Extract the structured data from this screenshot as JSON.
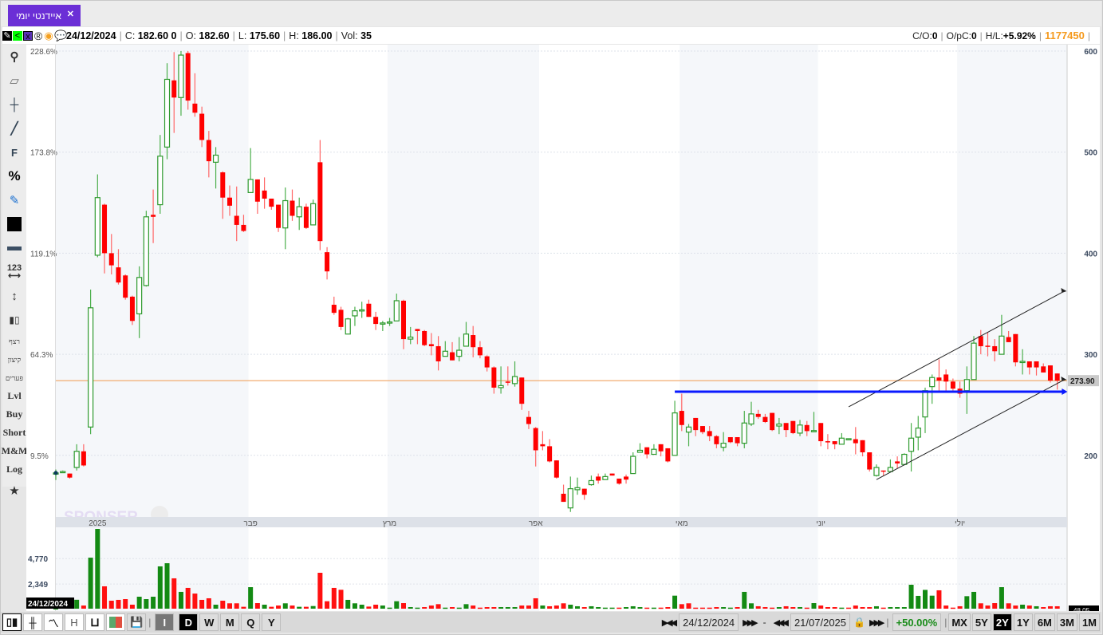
{
  "tab": {
    "title": "איידנטי יומי",
    "close_icon": "close-icon"
  },
  "info": {
    "date": "24/12/2024",
    "c_label": "C:",
    "c_value": "182.60 0",
    "o_label": "O:",
    "o_value": "182.60",
    "l_label": "L:",
    "l_value": "175.60",
    "h_label": "H:",
    "h_value": "186.00",
    "vol_label": "Vol:",
    "vol_value": "35",
    "co_label": "C/O:",
    "co_value": "0",
    "opc_label": "O/pC:",
    "opc_value": "0",
    "hl_label": "H/L:",
    "hl_value": "+5.92%",
    "code": "1177450",
    "icons": [
      "pencil-icon",
      "share-icon",
      "excel-icon",
      "registered-icon",
      "target-icon",
      "comment-icon"
    ]
  },
  "left_toolbar": {
    "icons": [
      "search-icon",
      "eraser-icon",
      "crosshair-icon",
      "line-tool-icon",
      "fibonacci-icon",
      "percent-icon",
      "edit-icon",
      "color-swatch-icon",
      "line-width-icon",
      "measure-icon",
      "vertical-arrow-icon",
      "candles-icon"
    ],
    "f_label": "F",
    "percent_label": "%",
    "measure_label": "123",
    "texts": [
      "רצף",
      "קיצון",
      "פערים",
      "Lvl",
      "Buy",
      "Short",
      "M&M",
      "Log"
    ],
    "star_icon": "star-icon"
  },
  "watermark": "SPONSER",
  "chart_data": {
    "type": "candlestick",
    "price_axis": {
      "ticks": [
        200,
        300,
        400,
        500,
        600
      ],
      "range": [
        130,
        600
      ]
    },
    "percent_axis": [
      "228.6%",
      "173.8%",
      "119.1%",
      "64.3%",
      "9.5%"
    ],
    "percent_axis_prices": [
      600,
      500,
      400,
      300,
      200
    ],
    "month_labels": [
      {
        "label": "2025",
        "index": 6
      },
      {
        "label": "פבר",
        "index": 28
      },
      {
        "label": "מרץ",
        "index": 48
      },
      {
        "label": "אפר",
        "index": 69
      },
      {
        "label": "מאי",
        "index": 90
      },
      {
        "label": "יוני",
        "index": 110
      },
      {
        "label": "יולי",
        "index": 130
      }
    ],
    "last_price": "273.90",
    "last_price_value": 273.9,
    "colors": {
      "up": "#2e9a2e",
      "down": "#ff0000",
      "last_line": "#f0a460",
      "support": "#0a1aff",
      "channel": "#222222"
    },
    "support_line": {
      "price": 263,
      "from_index": 89,
      "to_index": 145
    },
    "channel": [
      {
        "from": [
          114,
          248
        ],
        "to": [
          145,
          362.4
        ]
      },
      {
        "from": [
          118,
          176
        ],
        "to": [
          145,
          274.8
        ]
      }
    ],
    "candles_ohlc": [
      [
        182.6,
        186,
        175.6,
        182.6
      ],
      [
        183,
        185,
        183,
        184
      ],
      [
        182,
        182,
        177,
        178
      ],
      [
        188,
        211,
        185,
        204
      ],
      [
        204,
        211,
        189,
        190
      ],
      [
        228,
        364,
        221,
        346
      ],
      [
        398,
        478,
        396,
        455
      ],
      [
        448,
        449,
        380,
        400
      ],
      [
        400,
        419,
        379,
        388
      ],
      [
        386,
        404,
        369,
        371
      ],
      [
        378,
        379,
        354,
        356
      ],
      [
        357,
        358,
        329,
        333
      ],
      [
        340,
        387,
        316,
        376
      ],
      [
        368,
        442,
        367,
        436
      ],
      [
        438,
        463,
        410,
        436
      ],
      [
        448,
        517,
        439,
        496
      ],
      [
        505,
        588,
        493,
        572
      ],
      [
        571,
        599,
        519,
        554
      ],
      [
        554,
        600,
        536,
        596
      ],
      [
        598,
        600,
        542,
        551
      ],
      [
        548,
        578,
        535,
        539
      ],
      [
        538,
        545,
        505,
        512
      ],
      [
        512,
        521,
        475,
        491
      ],
      [
        490,
        505,
        464,
        497
      ],
      [
        480,
        481,
        434,
        455
      ],
      [
        455,
        467,
        437,
        447
      ],
      [
        437,
        466,
        412,
        428
      ],
      [
        428,
        438,
        421,
        422
      ],
      [
        460,
        504,
        460,
        473
      ],
      [
        473,
        473,
        439,
        451
      ],
      [
        462,
        475,
        444,
        454
      ],
      [
        454,
        454,
        443,
        446
      ],
      [
        448,
        448,
        421,
        425
      ],
      [
        425,
        465,
        404,
        452
      ],
      [
        452,
        463,
        432,
        437
      ],
      [
        436,
        455,
        423,
        446
      ],
      [
        446,
        449,
        424,
        425
      ],
      [
        428,
        453,
        428,
        449
      ],
      [
        490,
        512,
        403,
        412
      ],
      [
        401,
        406,
        374,
        382
      ],
      [
        349,
        357,
        339,
        341
      ],
      [
        344,
        347,
        324,
        327
      ],
      [
        320,
        336,
        320,
        335
      ],
      [
        338,
        347,
        328,
        343
      ],
      [
        343,
        352,
        336,
        344
      ],
      [
        350,
        354,
        337,
        337
      ],
      [
        337,
        342,
        324,
        330
      ],
      [
        330,
        333,
        323,
        331
      ],
      [
        331,
        336,
        328,
        332
      ],
      [
        333,
        360,
        333,
        353
      ],
      [
        353,
        354,
        305,
        315
      ],
      [
        315,
        327,
        310,
        317
      ],
      [
        325,
        325,
        310,
        323
      ],
      [
        323,
        324,
        308,
        309
      ],
      [
        310,
        321,
        299,
        308
      ],
      [
        308,
        318,
        284,
        293
      ],
      [
        298,
        313,
        298,
        303
      ],
      [
        302,
        312,
        294,
        294
      ],
      [
        298,
        317,
        293,
        304
      ],
      [
        308,
        332,
        308,
        320
      ],
      [
        319,
        328,
        297,
        307
      ],
      [
        307,
        313,
        296,
        299
      ],
      [
        298,
        299,
        283,
        287
      ],
      [
        287,
        288,
        261,
        267
      ],
      [
        267,
        288,
        261,
        269
      ],
      [
        273,
        288,
        269,
        272
      ],
      [
        271,
        293,
        268,
        278
      ],
      [
        277,
        277,
        245,
        251
      ],
      [
        238,
        244,
        226,
        231
      ],
      [
        227,
        228,
        189,
        205
      ],
      [
        211,
        224,
        205,
        209
      ],
      [
        209,
        216,
        193,
        194
      ],
      [
        195,
        195,
        177,
        178
      ],
      [
        162,
        171,
        154,
        154
      ],
      [
        148,
        179,
        144,
        167
      ],
      [
        166,
        178,
        161,
        168
      ],
      [
        167,
        167,
        156,
        161
      ],
      [
        171,
        180,
        170,
        175
      ],
      [
        179,
        182,
        172,
        175
      ],
      [
        176,
        182,
        176,
        179
      ],
      [
        182,
        182,
        180,
        180
      ],
      [
        177,
        177,
        171,
        172
      ],
      [
        179,
        181,
        172,
        176
      ],
      [
        182,
        203,
        182,
        199
      ],
      [
        203,
        212,
        203,
        205
      ],
      [
        208,
        208,
        197,
        201
      ],
      [
        201,
        211,
        201,
        206
      ],
      [
        211,
        211,
        199,
        204
      ],
      [
        207,
        207,
        193,
        194
      ],
      [
        200,
        254,
        200,
        242
      ],
      [
        244,
        261,
        224,
        230
      ],
      [
        223,
        231,
        209,
        228
      ],
      [
        237,
        237,
        219,
        225
      ],
      [
        229,
        229,
        221,
        223
      ],
      [
        224,
        229,
        214,
        219
      ],
      [
        219,
        220,
        207,
        211
      ],
      [
        208,
        223,
        204,
        212
      ],
      [
        218,
        218,
        212,
        213
      ],
      [
        218,
        218,
        209,
        212
      ],
      [
        212,
        244,
        207,
        232
      ],
      [
        231,
        253,
        229,
        241
      ],
      [
        241,
        245,
        236,
        238
      ],
      [
        238,
        241,
        232,
        233
      ],
      [
        242,
        242,
        224,
        225
      ],
      [
        229,
        237,
        221,
        231
      ],
      [
        232,
        232,
        218,
        225
      ],
      [
        234,
        234,
        221,
        222
      ],
      [
        222,
        235,
        219,
        230
      ],
      [
        230,
        234,
        219,
        224
      ],
      [
        224,
        243,
        223,
        224.5
      ],
      [
        232,
        232,
        209,
        214
      ],
      [
        214,
        221,
        206,
        213
      ],
      [
        214,
        214,
        206,
        211
      ],
      [
        211,
        222,
        211,
        217
      ],
      [
        216,
        216.5,
        215.5,
        216.5
      ],
      [
        216,
        228,
        201,
        212
      ],
      [
        215,
        215,
        199,
        203
      ],
      [
        203,
        203,
        184,
        186
      ],
      [
        180,
        191,
        179,
        188
      ],
      [
        185,
        185,
        180,
        184
      ],
      [
        184,
        196,
        183,
        188
      ],
      [
        194,
        199,
        187,
        192
      ],
      [
        191,
        202,
        190,
        201
      ],
      [
        204,
        232,
        184,
        217
      ],
      [
        218,
        239,
        205,
        227
      ],
      [
        238,
        267,
        222,
        264
      ],
      [
        268,
        280,
        251,
        277
      ],
      [
        277,
        295,
        264,
        274
      ],
      [
        280,
        285,
        264,
        273
      ],
      [
        273,
        276,
        264,
        266
      ],
      [
        266,
        273,
        257,
        261
      ],
      [
        264,
        288,
        241,
        275
      ],
      [
        275,
        318,
        275,
        311
      ],
      [
        318,
        324,
        300,
        308
      ],
      [
        308.5,
        322,
        298,
        308
      ],
      [
        308,
        315,
        293,
        303
      ],
      [
        300,
        339,
        300,
        318
      ],
      [
        317,
        323,
        312,
        312
      ],
      [
        320,
        320,
        288,
        292
      ],
      [
        292.7,
        305,
        280,
        293
      ],
      [
        293,
        293,
        280,
        287
      ],
      [
        293,
        293,
        279,
        287
      ],
      [
        288,
        291,
        282,
        282
      ],
      [
        289,
        289,
        272,
        274
      ],
      [
        281,
        281,
        265,
        273.9
      ]
    ],
    "volume_axis": {
      "ticks": [
        "4,770",
        "2,349"
      ],
      "tick_values": [
        4770,
        2349
      ],
      "cursor_date": "24/12/2024",
      "right_label": "48.05"
    },
    "volumes": [
      [
        35,
        "g"
      ],
      [
        120,
        "g"
      ],
      [
        150,
        "r"
      ],
      [
        850,
        "g"
      ],
      [
        300,
        "r"
      ],
      [
        4860,
        "g"
      ],
      [
        7600,
        "g"
      ],
      [
        2130,
        "r"
      ],
      [
        760,
        "r"
      ],
      [
        840,
        "r"
      ],
      [
        910,
        "r"
      ],
      [
        380,
        "r"
      ],
      [
        1140,
        "g"
      ],
      [
        910,
        "g"
      ],
      [
        1140,
        "g"
      ],
      [
        4030,
        "g"
      ],
      [
        4330,
        "g"
      ],
      [
        2890,
        "r"
      ],
      [
        1600,
        "g"
      ],
      [
        1980,
        "r"
      ],
      [
        1440,
        "r"
      ],
      [
        840,
        "r"
      ],
      [
        990,
        "r"
      ],
      [
        380,
        "g"
      ],
      [
        760,
        "r"
      ],
      [
        510,
        "r"
      ],
      [
        510,
        "r"
      ],
      [
        180,
        "r"
      ],
      [
        2050,
        "g"
      ],
      [
        530,
        "r"
      ],
      [
        380,
        "g"
      ],
      [
        180,
        "r"
      ],
      [
        300,
        "r"
      ],
      [
        510,
        "g"
      ],
      [
        300,
        "r"
      ],
      [
        180,
        "g"
      ],
      [
        180,
        "r"
      ],
      [
        250,
        "g"
      ],
      [
        3420,
        "r"
      ],
      [
        710,
        "r"
      ],
      [
        1980,
        "r"
      ],
      [
        1800,
        "r"
      ],
      [
        840,
        "g"
      ],
      [
        510,
        "g"
      ],
      [
        380,
        "g"
      ],
      [
        200,
        "r"
      ],
      [
        380,
        "r"
      ],
      [
        300,
        "g"
      ],
      [
        100,
        "g"
      ],
      [
        710,
        "g"
      ],
      [
        530,
        "r"
      ],
      [
        150,
        "g"
      ],
      [
        100,
        "g"
      ],
      [
        150,
        "r"
      ],
      [
        300,
        "r"
      ],
      [
        430,
        "r"
      ],
      [
        100,
        "g"
      ],
      [
        150,
        "r"
      ],
      [
        100,
        "g"
      ],
      [
        430,
        "g"
      ],
      [
        300,
        "r"
      ],
      [
        100,
        "r"
      ],
      [
        150,
        "r"
      ],
      [
        150,
        "r"
      ],
      [
        150,
        "g"
      ],
      [
        150,
        "g"
      ],
      [
        150,
        "g"
      ],
      [
        300,
        "r"
      ],
      [
        300,
        "r"
      ],
      [
        990,
        "r"
      ],
      [
        300,
        "g"
      ],
      [
        230,
        "r"
      ],
      [
        300,
        "r"
      ],
      [
        510,
        "r"
      ],
      [
        380,
        "g"
      ],
      [
        230,
        "g"
      ],
      [
        150,
        "r"
      ],
      [
        230,
        "g"
      ],
      [
        150,
        "g"
      ],
      [
        100,
        "g"
      ],
      [
        100,
        "g"
      ],
      [
        100,
        "r"
      ],
      [
        150,
        "g"
      ],
      [
        230,
        "g"
      ],
      [
        150,
        "g"
      ],
      [
        100,
        "r"
      ],
      [
        100,
        "g"
      ],
      [
        100,
        "r"
      ],
      [
        150,
        "r"
      ],
      [
        1240,
        "g"
      ],
      [
        430,
        "r"
      ],
      [
        510,
        "r"
      ],
      [
        100,
        "r"
      ],
      [
        100,
        "r"
      ],
      [
        100,
        "r"
      ],
      [
        150,
        "r"
      ],
      [
        150,
        "g"
      ],
      [
        100,
        "g"
      ],
      [
        150,
        "r"
      ],
      [
        1600,
        "g"
      ],
      [
        510,
        "g"
      ],
      [
        230,
        "r"
      ],
      [
        150,
        "r"
      ],
      [
        100,
        "r"
      ],
      [
        150,
        "g"
      ],
      [
        230,
        "r"
      ],
      [
        150,
        "r"
      ],
      [
        150,
        "g"
      ],
      [
        100,
        "r"
      ],
      [
        530,
        "g"
      ],
      [
        300,
        "r"
      ],
      [
        150,
        "r"
      ],
      [
        150,
        "r"
      ],
      [
        100,
        "g"
      ],
      [
        100,
        "r"
      ],
      [
        300,
        "r"
      ],
      [
        150,
        "r"
      ],
      [
        150,
        "r"
      ],
      [
        230,
        "g"
      ],
      [
        100,
        "r"
      ],
      [
        150,
        "g"
      ],
      [
        150,
        "g"
      ],
      [
        150,
        "g"
      ],
      [
        2280,
        "g"
      ],
      [
        1220,
        "g"
      ],
      [
        1790,
        "g"
      ],
      [
        1240,
        "g"
      ],
      [
        1750,
        "r"
      ],
      [
        300,
        "r"
      ],
      [
        100,
        "r"
      ],
      [
        230,
        "r"
      ],
      [
        1190,
        "g"
      ],
      [
        1600,
        "g"
      ],
      [
        510,
        "r"
      ],
      [
        300,
        "r"
      ],
      [
        530,
        "r"
      ],
      [
        2050,
        "g"
      ],
      [
        510,
        "r"
      ],
      [
        300,
        "r"
      ],
      [
        380,
        "g"
      ],
      [
        300,
        "r"
      ],
      [
        230,
        "g"
      ],
      [
        150,
        "r"
      ],
      [
        230,
        "r"
      ],
      [
        230,
        "r"
      ]
    ]
  },
  "bottom_toolbar": {
    "chart_types": [
      "candlestick-icon",
      "ohlc-bar-icon",
      "line-chart-icon",
      "H",
      "U",
      "color-bars-icon",
      "save-icon"
    ],
    "h_label": "H",
    "intervals": [
      "I",
      "D",
      "W",
      "M",
      "Q",
      "Y"
    ],
    "selected_interval": "D",
    "start_date": "24/12/2024",
    "end_date": "21/07/2025",
    "dash": "-",
    "change": "+50.00%",
    "ranges": [
      "MX",
      "5Y",
      "2Y",
      "1Y",
      "6M",
      "3M",
      "1M"
    ],
    "selected_range": "2Y"
  }
}
